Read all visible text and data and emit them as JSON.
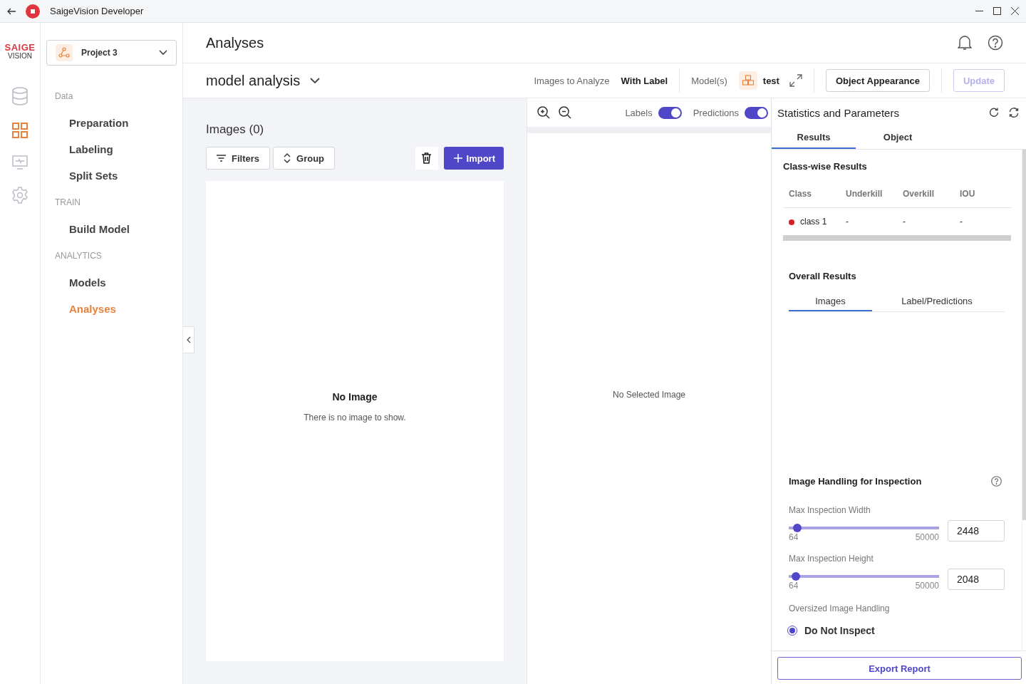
{
  "titlebar": {
    "title": "SaigeVision Developer"
  },
  "logo": {
    "line1": "SAIGE",
    "line2": "VISION"
  },
  "rail": [
    {
      "kind": "database",
      "selected": false
    },
    {
      "kind": "grid",
      "selected": true
    },
    {
      "kind": "monitor",
      "selected": false
    },
    {
      "kind": "settings",
      "selected": false
    }
  ],
  "project": {
    "name": "Project 3"
  },
  "nav": [
    {
      "section": "Data",
      "items": [
        {
          "label": "Preparation",
          "selected": false
        },
        {
          "label": "Labeling",
          "selected": false
        },
        {
          "label": "Split Sets",
          "selected": false
        }
      ]
    },
    {
      "section": "TRAIN",
      "items": [
        {
          "label": "Build Model",
          "selected": false
        }
      ]
    },
    {
      "section": "ANALYTICS",
      "items": [
        {
          "label": "Models",
          "selected": false
        },
        {
          "label": "Analyses",
          "selected": true
        }
      ]
    }
  ],
  "page_title": "Analyses",
  "analysis": {
    "name": "model analysis",
    "images_label": "Images to Analyze",
    "images_value": "With Label",
    "models_label": "Model(s)",
    "model_name": "test"
  },
  "actions": [
    {
      "label": "Object Appearance",
      "disabled": false
    },
    {
      "label": "Update",
      "disabled": true
    }
  ],
  "images_panel": {
    "title": "Images (0)",
    "filters": "Filters",
    "group": "Group",
    "import": "Import",
    "empty_title": "No Image",
    "empty_text": "There is no image to show."
  },
  "viewer": {
    "toggles": [
      {
        "label": "Labels",
        "on": true
      },
      {
        "label": "Predictions",
        "on": true
      }
    ],
    "empty_text": "No Selected Image"
  },
  "stats": {
    "title": "Statistics and Parameters",
    "tabs": [
      {
        "label": "Results",
        "selected": true
      },
      {
        "label": "Object",
        "selected": false
      }
    ],
    "classwise_title": "Class-wise Results",
    "columns": [
      "Class",
      "Underkill",
      "Overkill",
      "IOU"
    ],
    "rows": [
      {
        "color": "#d71e28",
        "cells": [
          "class 1",
          "-",
          "-",
          "-"
        ]
      }
    ],
    "overall_title": "Overall Results",
    "overall_tabs": [
      {
        "label": "Images",
        "selected": true
      },
      {
        "label": "Label/Predictions",
        "selected": false
      }
    ],
    "handling_title": "Image Handling for Inspection",
    "sliders": [
      {
        "label": "Max Inspection Width",
        "level": 0.03,
        "min": "64",
        "max": "50000",
        "value": "2448"
      },
      {
        "label": "Max Inspection Height",
        "level": 0.02,
        "min": "64",
        "max": "50000",
        "value": "2048"
      }
    ],
    "oversized_label": "Oversized Image Handling",
    "options": [
      {
        "label": "Do Not Inspect",
        "selected": true
      }
    ],
    "export": "Export Report"
  }
}
